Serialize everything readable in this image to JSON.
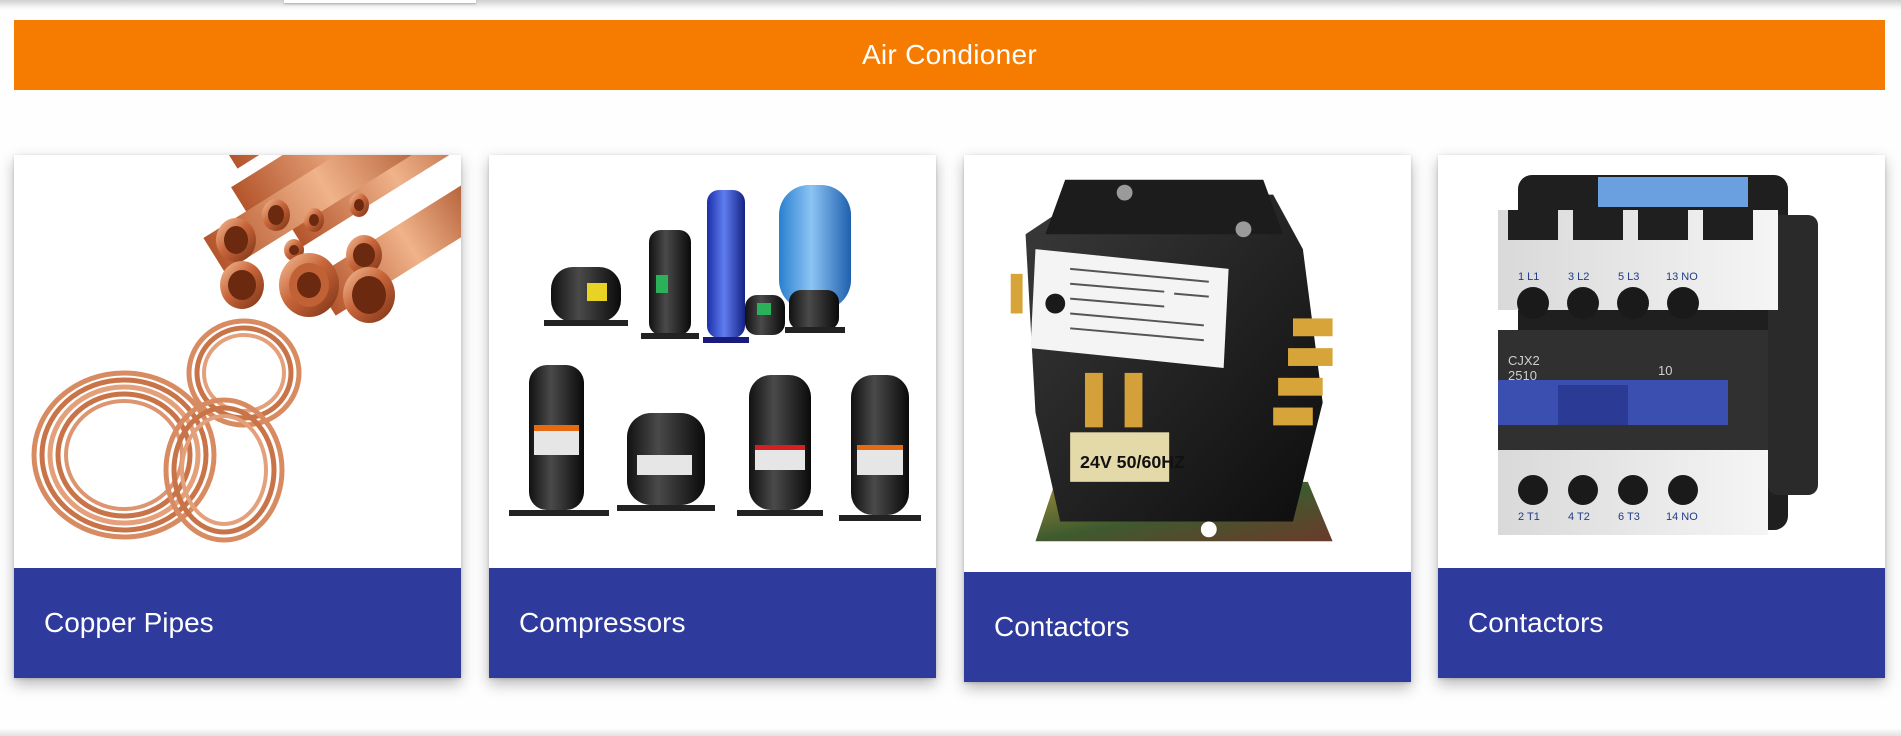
{
  "banner": {
    "title": "Air Condioner",
    "color": "#f57c00"
  },
  "cards": [
    {
      "label": "Copper Pipes",
      "image": "copper-pipes-image"
    },
    {
      "label": "Compressors",
      "image": "compressors-image"
    },
    {
      "label": "Contactors",
      "image": "contactor-image"
    },
    {
      "label": "Contactors",
      "image": "contactor-image"
    }
  ],
  "colors": {
    "caption_bg": "#2f3b9c",
    "caption_text": "#ffffff",
    "banner_text": "#ffffff"
  }
}
